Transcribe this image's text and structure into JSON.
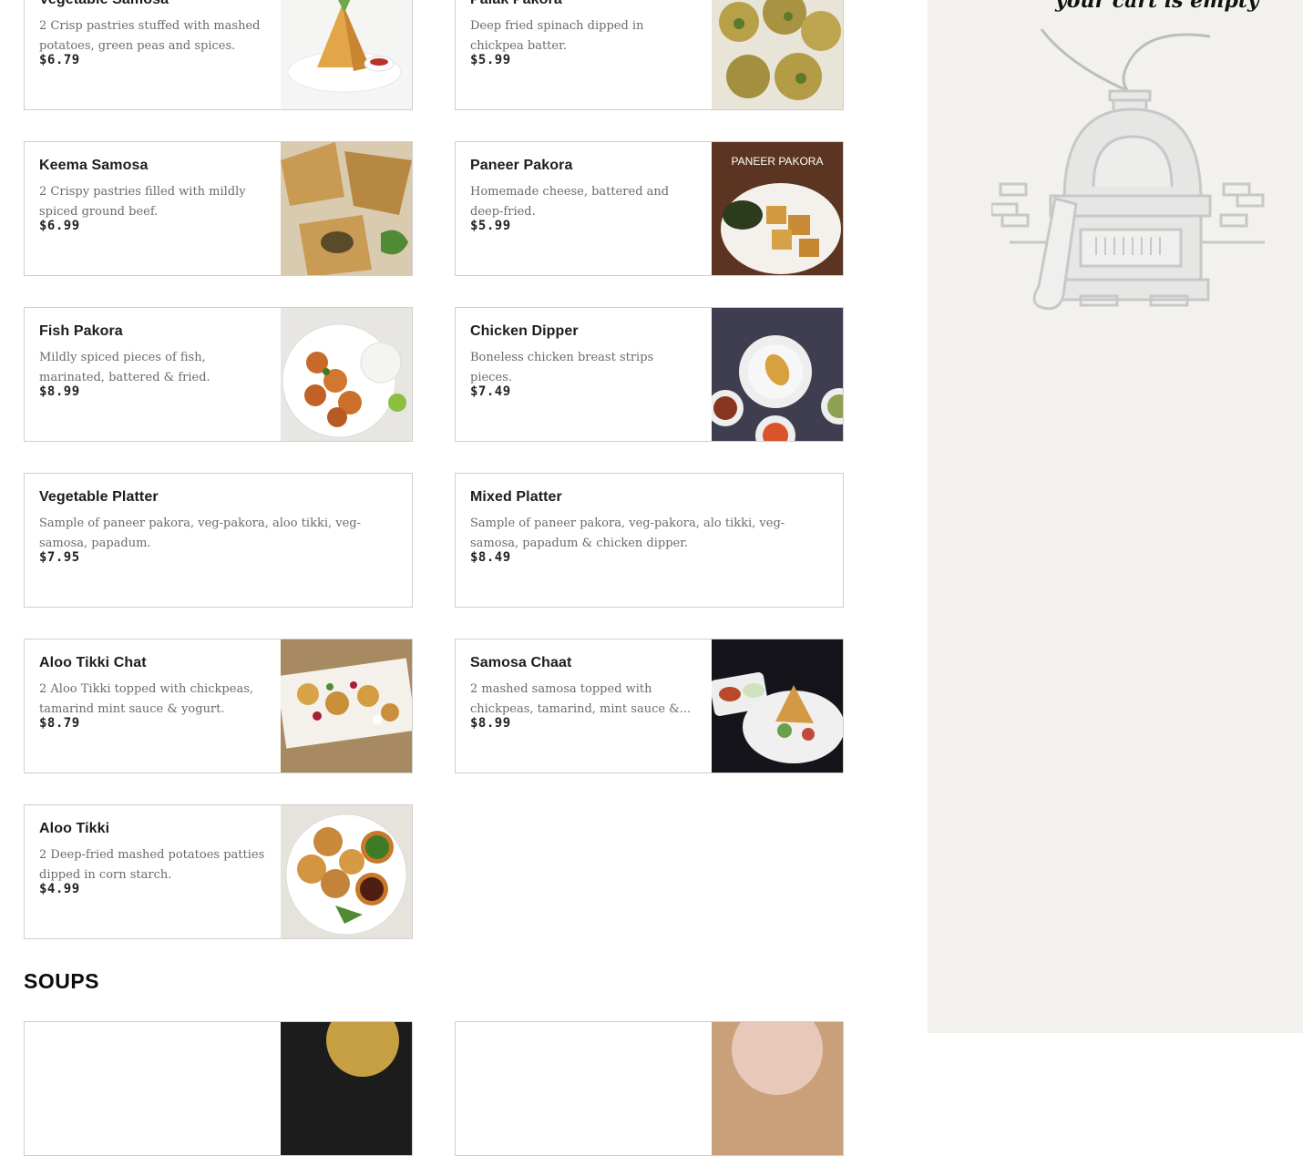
{
  "menu": {
    "items": [
      {
        "name": "Vegetable Samosa",
        "desc": "2 Crisp pastries stuffed with mashed potatoes, green peas and spices.",
        "price": "$6.79",
        "image": "samosa-photo"
      },
      {
        "name": "Palak Pakora",
        "desc": "Deep fried spinach dipped in chickpea batter.",
        "price": "$5.99",
        "image": "pakora-photo"
      },
      {
        "name": "Keema Samosa",
        "desc": "2 Crispy pastries filled with mildly spiced ground beef.",
        "price": "$6.99",
        "image": "keema-samosa-photo"
      },
      {
        "name": "Paneer Pakora",
        "desc": "Homemade cheese, battered and deep-fried.",
        "price": "$5.99",
        "image": "paneer-pakora-photo",
        "image_caption": "PANEER PAKORA"
      },
      {
        "name": "Fish Pakora",
        "desc": "Mildly spiced pieces of fish, marinated, battered & fried.",
        "price": "$8.99",
        "image": "fish-pakora-photo"
      },
      {
        "name": "Chicken Dipper",
        "desc": "Boneless chicken breast strips pieces.",
        "price": "$7.49",
        "image": "chicken-dipper-photo"
      },
      {
        "name": "Vegetable Platter",
        "desc": "Sample of paneer pakora, veg-pakora, aloo tikki, veg-samosa, papadum.",
        "price": "$7.95"
      },
      {
        "name": "Mixed Platter",
        "desc": "Sample of paneer pakora, veg-pakora, alo tikki, veg-samosa, papadum & chicken dipper.",
        "price": "$8.49"
      },
      {
        "name": "Aloo Tikki Chat",
        "desc": "2 Aloo Tikki topped with chickpeas, tamarind mint sauce & yogurt.",
        "price": "$8.79",
        "image": "tikki-chat-photo"
      },
      {
        "name": "Samosa Chaat",
        "desc": "2 mashed samosa topped with chickpeas, tamarind, mint sauce &...",
        "price": "$8.99",
        "image": "samosa-chaat-photo"
      },
      {
        "name": "Aloo Tikki",
        "desc": "2 Deep-fried mashed potatoes patties dipped in corn starch.",
        "price": "$4.99",
        "image": "aloo-tikki-photo"
      }
    ],
    "next_section": "SOUPS"
  },
  "cart": {
    "empty_text": "your cart is empty",
    "illustration": "pizza-oven-illustration",
    "panel_color": "#f2f1ee"
  }
}
